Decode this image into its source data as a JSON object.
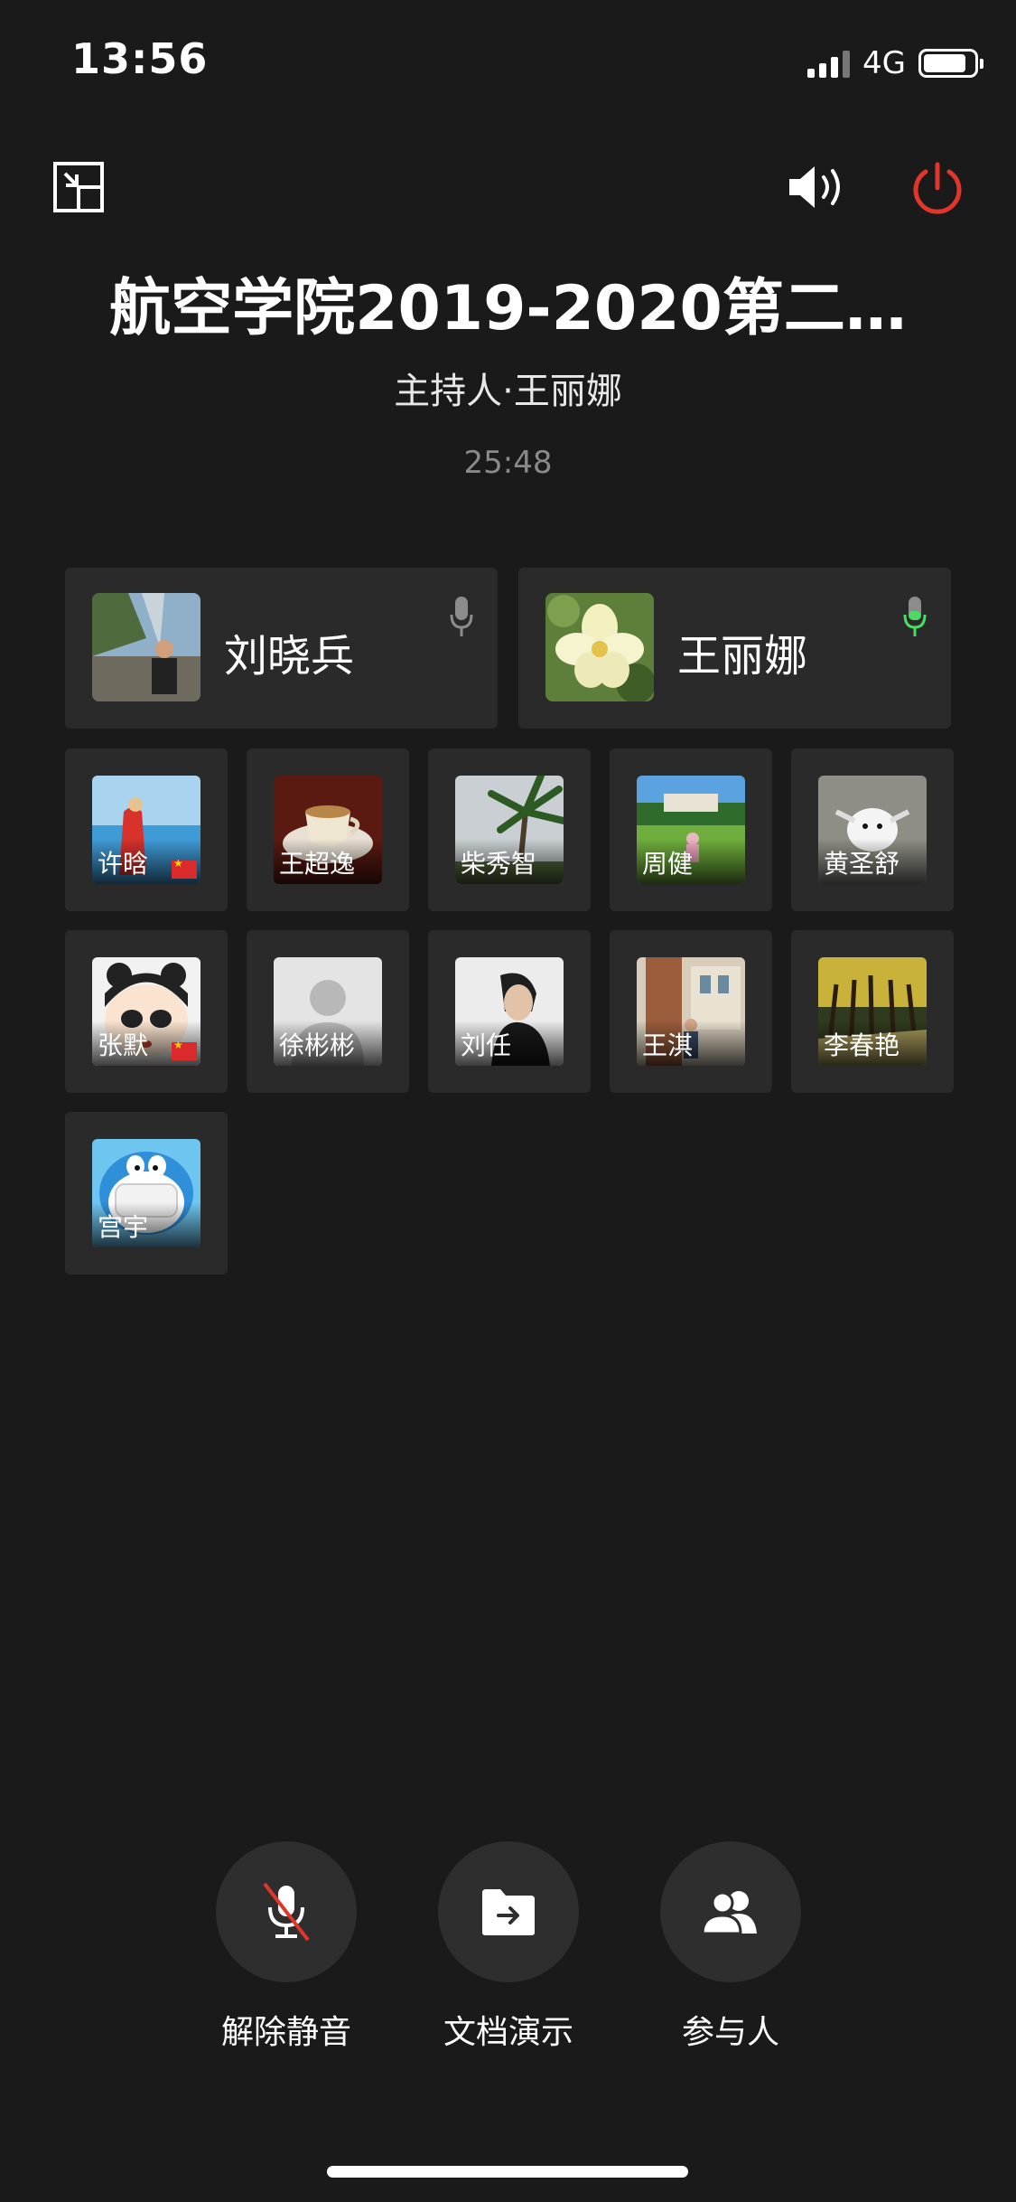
{
  "status_bar": {
    "time": "13:56",
    "network": "4G",
    "battery_level": 0.85
  },
  "meeting": {
    "title": "航空学院2019-2020第二…",
    "host_label": "主持人·王丽娜",
    "elapsed": "25:48"
  },
  "speakers": [
    {
      "name": "刘晓兵",
      "mic_color": "#8c8c8c"
    },
    {
      "name": "王丽娜",
      "mic_color": "#4cd964"
    }
  ],
  "participants": [
    {
      "name": "许晗",
      "flag": true
    },
    {
      "name": "王超逸",
      "flag": false
    },
    {
      "name": "柴秀智",
      "flag": false
    },
    {
      "name": "周健",
      "flag": false
    },
    {
      "name": "黄圣舒",
      "flag": false
    },
    {
      "name": "张默",
      "flag": true
    },
    {
      "name": "徐彬彬",
      "flag": false
    },
    {
      "name": "刘任",
      "flag": false
    },
    {
      "name": "王淇",
      "flag": false
    },
    {
      "name": "李春艳",
      "flag": false
    },
    {
      "name": "宫宇",
      "flag": false
    }
  ],
  "controls": {
    "unmute_label": "解除静音",
    "share_doc_label": "文档演示",
    "participants_label": "参与人"
  },
  "colors": {
    "background": "#1a1a1a",
    "tile": "#2a2a2a",
    "power": "#e0362c",
    "mute_slash": "#e0362c"
  },
  "icons": [
    "minimize-icon",
    "speaker-icon",
    "power-icon",
    "mic-icon",
    "mic-muted-icon",
    "folder-share-icon",
    "people-icon"
  ]
}
